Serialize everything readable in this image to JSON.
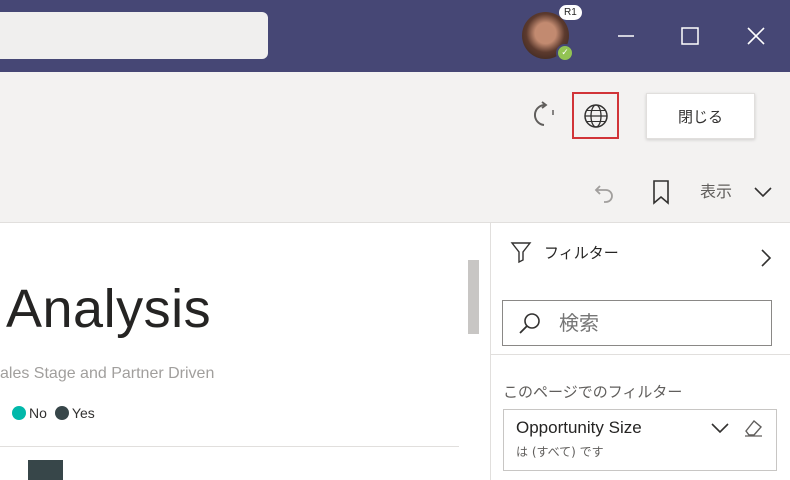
{
  "titlebar": {
    "avatar_ring_label": "R1",
    "presence_status": "available",
    "window_controls": [
      "minimize-icon",
      "maximize-icon",
      "close-icon"
    ]
  },
  "toolbar": {
    "refresh_icon": "refresh-icon",
    "globe_icon": "globe-icon",
    "close_label": "閉じる",
    "undo_icon": "undo-icon",
    "bookmark_icon": "bookmark-icon",
    "view_label": "表示"
  },
  "report": {
    "title": "Analysis",
    "subtitle": "ales Stage and Partner Driven",
    "legend": [
      {
        "label": "No",
        "color": "#01b8aa"
      },
      {
        "label": "Yes",
        "color": "#374649"
      }
    ]
  },
  "filters": {
    "header": "フィルター",
    "search_placeholder": "検索",
    "page_section_label": "このページでのフィルター",
    "cards": [
      {
        "name": "Opportunity Size",
        "summary": "は (すべて) です"
      }
    ]
  },
  "colors": {
    "titlebar": "#464775",
    "highlight": "#d13438",
    "presence": "#92c353"
  }
}
